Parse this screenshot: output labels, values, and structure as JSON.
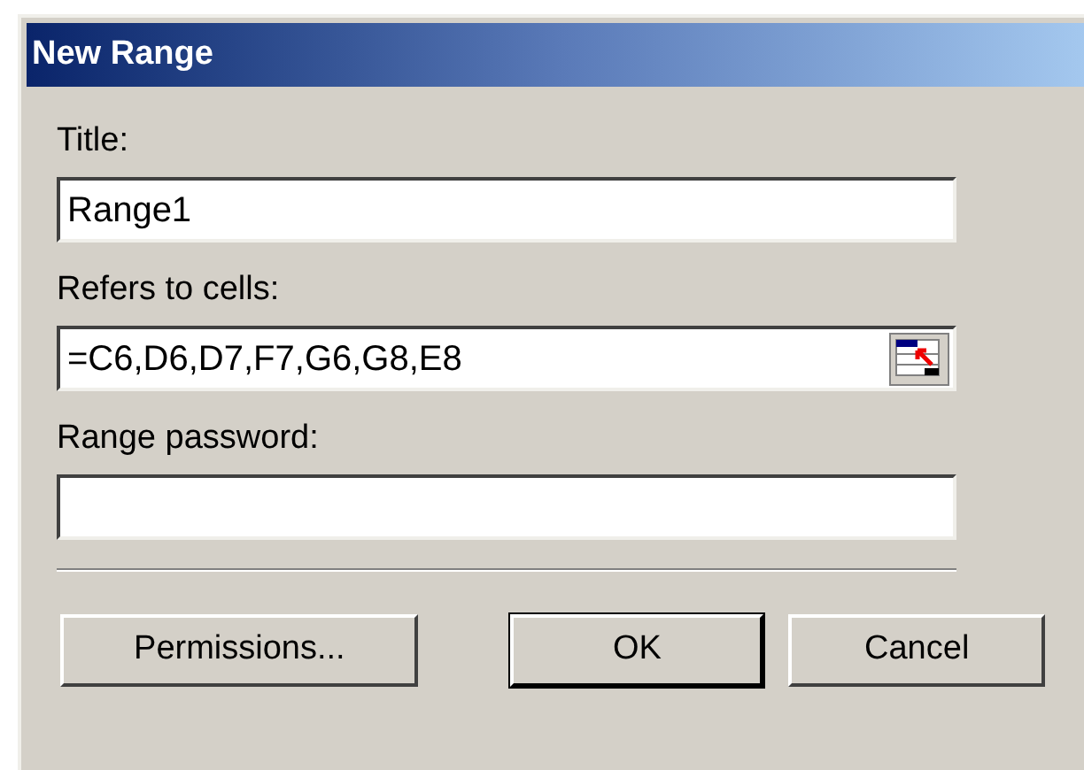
{
  "window": {
    "title": "New Range"
  },
  "fields": [
    {
      "label": "Title:",
      "value": "Range1",
      "picker": false
    },
    {
      "label": "Refers to cells:",
      "value": "=C6,D6,D7,F7,G6,G8,E8",
      "picker": true
    },
    {
      "label": "Range password:",
      "picker": false
    }
  ],
  "buttons": [
    {
      "label": "Permissions...",
      "default": false
    },
    {
      "label": "OK",
      "default": true
    },
    {
      "label": "Cancel",
      "default": false
    }
  ]
}
